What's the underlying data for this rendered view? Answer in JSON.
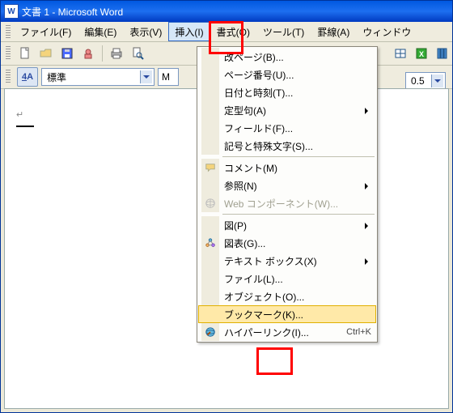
{
  "window": {
    "title": "文書 1 - Microsoft Word",
    "app_icon_letter": "W"
  },
  "menubar": {
    "file": "ファイル(F)",
    "edit": "編集(E)",
    "view": "表示(V)",
    "insert": "挿入(I)",
    "format": "書式(O)",
    "tools": "ツール(T)",
    "table": "罫線(A)",
    "window": "ウィンドウ"
  },
  "formatbar": {
    "aa": "A",
    "style": "標準",
    "font_first_letter": "M",
    "right_value": "0.5"
  },
  "document": {
    "paragraph_mark": "↵"
  },
  "insert_menu": {
    "page_break": "改ページ(B)...",
    "page_numbers": "ページ番号(U)...",
    "date_time": "日付と時刻(T)...",
    "autotext": "定型句(A)",
    "field": "フィールド(F)...",
    "symbol": "記号と特殊文字(S)...",
    "comment": "コメント(M)",
    "reference": "参照(N)",
    "web_component": "Web コンポーネント(W)...",
    "picture": "図(P)",
    "diagram": "図表(G)...",
    "textbox": "テキスト ボックス(X)",
    "file": "ファイル(L)...",
    "object": "オブジェクト(O)...",
    "bookmark": "ブックマーク(K)...",
    "hyperlink": "ハイパーリンク(I)...",
    "hyperlink_shortcut": "Ctrl+K"
  }
}
